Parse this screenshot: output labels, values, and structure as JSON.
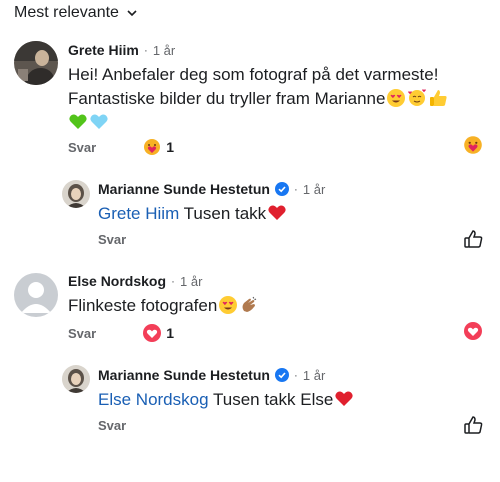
{
  "sort": {
    "label": "Mest relevante"
  },
  "colors": {
    "mention": "#1a5fb4",
    "meta": "#65676b",
    "verified": "#1877f2",
    "heart": "#e0245e"
  },
  "comments": [
    {
      "author": "Grete Hiim",
      "age": "1 år",
      "text_line1": "Hei! Anbefaler deg som fotograf på det varmeste!",
      "text_line2": "Fantastiske bilder du tryller fram Marianne",
      "reply_label": "Svar",
      "reaction_icon": "care-emoji-icon",
      "reaction_count": "1",
      "reply": {
        "author": "Marianne Sunde Hestetun",
        "age": "1 år",
        "mention": "Grete Hiim",
        "text": "Tusen takk",
        "reply_label": "Svar"
      }
    },
    {
      "author": "Else Nordskog",
      "age": "1 år",
      "text": "Flinkeste fotografen",
      "reply_label": "Svar",
      "reaction_icon": "love-icon",
      "reaction_count": "1",
      "reply": {
        "author": "Marianne Sunde Hestetun",
        "age": "1 år",
        "mention": "Else Nordskog",
        "text": "Tusen takk Else",
        "reply_label": "Svar"
      }
    }
  ]
}
